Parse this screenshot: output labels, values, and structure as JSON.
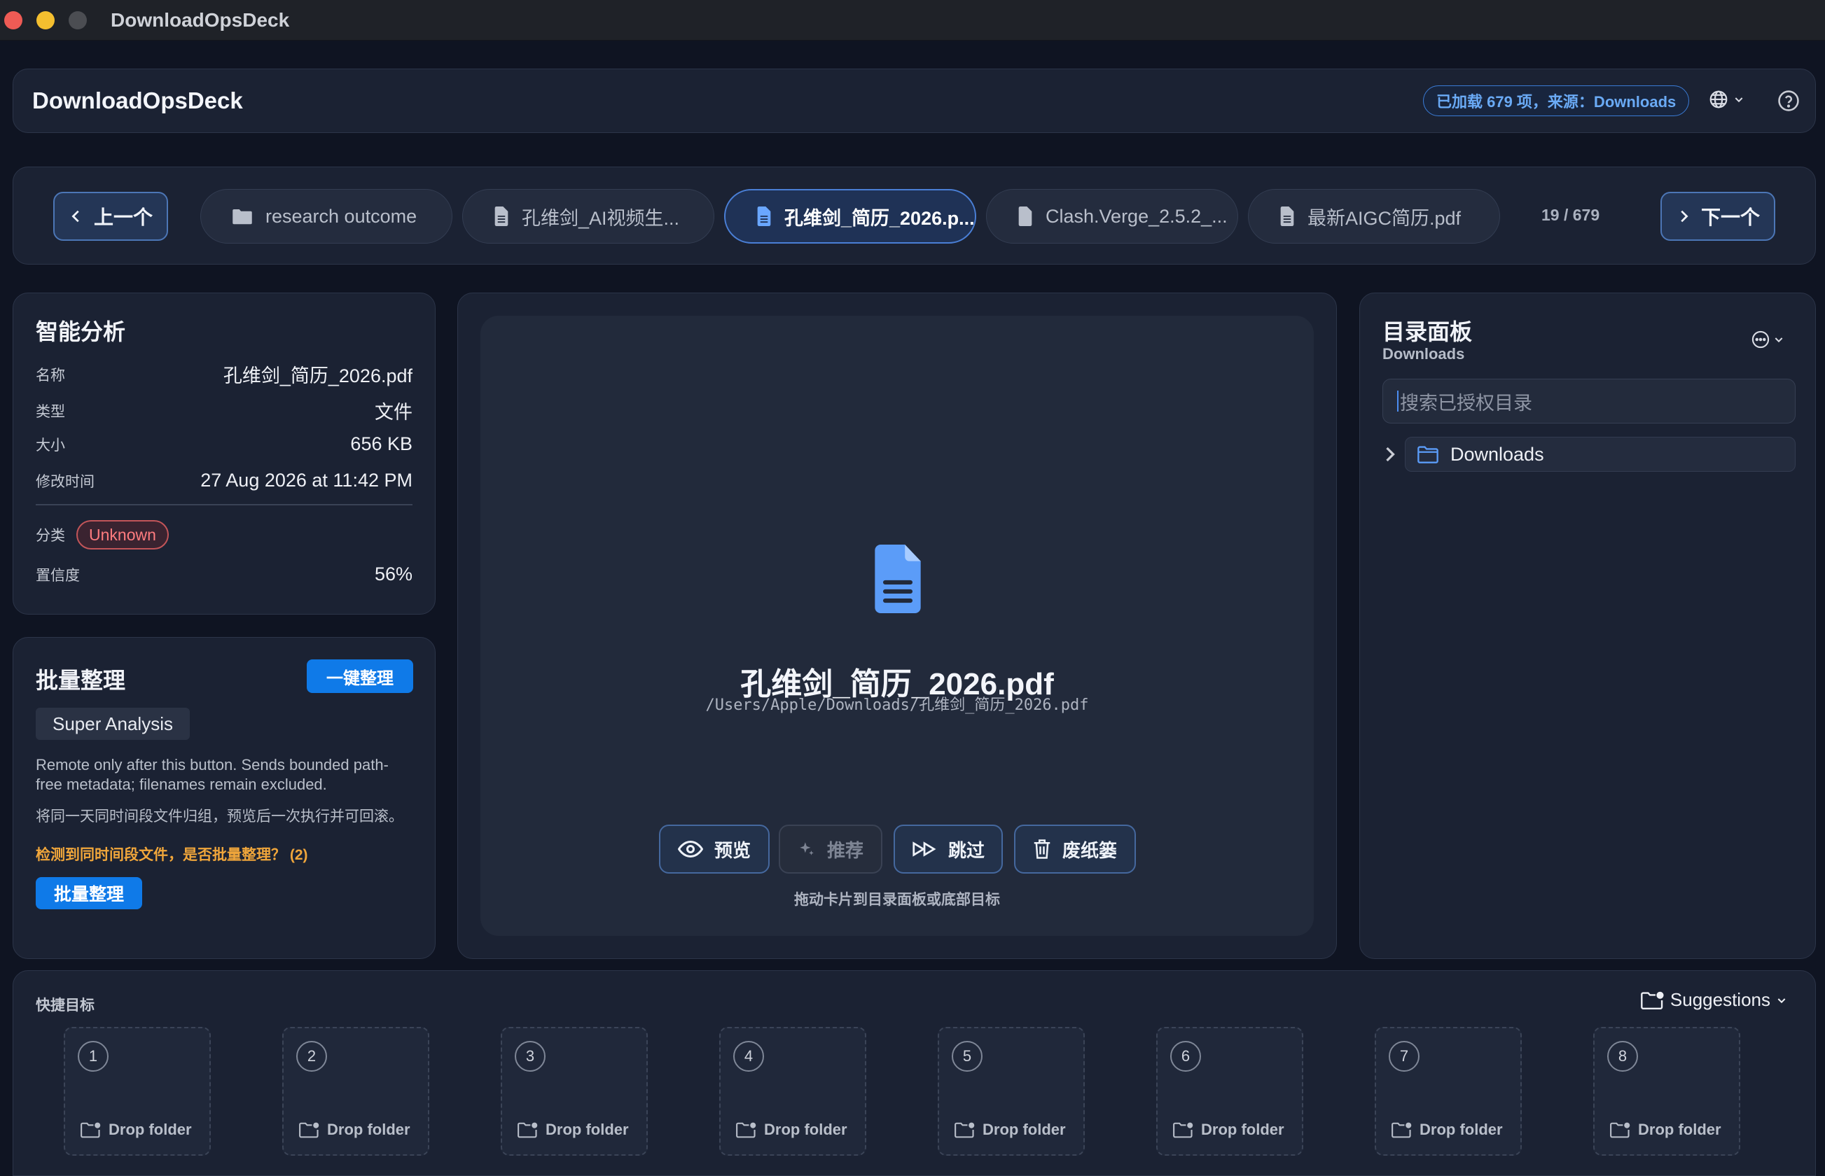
{
  "window": {
    "title": "DownloadOpsDeck"
  },
  "header": {
    "app_name": "DownloadOpsDeck",
    "status": "已加载 679 项，来源：Downloads"
  },
  "nav": {
    "prev_label": "上一个",
    "next_label": "下一个",
    "counter": "19 / 679",
    "tabs": [
      {
        "label": "research outcome",
        "icon": "folder-icon",
        "active": false
      },
      {
        "label": "孔维剑_AI视频生...",
        "icon": "document-icon",
        "active": false
      },
      {
        "label": "孔维剑_简历_2026.p...",
        "icon": "document-icon",
        "active": true
      },
      {
        "label": "Clash.Verge_2.5.2_...",
        "icon": "file-icon",
        "active": false
      },
      {
        "label": "最新AIGC简历.pdf",
        "icon": "document-icon",
        "active": false
      }
    ]
  },
  "analysis": {
    "title": "智能分析",
    "rows": [
      {
        "key": "名称",
        "value": "孔维剑_简历_2026.pdf"
      },
      {
        "key": "类型",
        "value": "文件"
      },
      {
        "key": "大小",
        "value": "656 KB"
      },
      {
        "key": "修改时间",
        "value": "27 Aug 2026 at 11:42 PM"
      }
    ],
    "category_key": "分类",
    "category_value": "Unknown",
    "confidence_key": "置信度",
    "confidence_value": "56%"
  },
  "batch": {
    "title": "批量整理",
    "one_click_label": "一键整理",
    "super_analysis_label": "Super Analysis",
    "note_remote": "Remote only after this button. Sends bounded path-free metadata; filenames remain excluded.",
    "note_group": "将同一天同时间段文件归组，预览后一次执行并可回滚。",
    "warning": "检测到同时间段文件，是否批量整理？ (2)",
    "batch_button_label": "批量整理"
  },
  "preview": {
    "file_name": "孔维剑_简历_2026.pdf",
    "file_path": "/Users/Apple/Downloads/孔维剑_简历_2026.pdf",
    "actions": {
      "preview": "预览",
      "recommend": "推荐",
      "skip": "跳过",
      "trash": "废纸篓"
    },
    "drag_hint": "拖动卡片到目录面板或底部目标"
  },
  "directory": {
    "title": "目录面板",
    "subtitle": "Downloads",
    "search_placeholder": "搜索已授权目录",
    "tree": [
      {
        "label": "Downloads"
      }
    ]
  },
  "quick_targets": {
    "title": "快捷目标",
    "suggestions_label": "Suggestions",
    "slots": [
      {
        "num": "1",
        "label": "Drop folder"
      },
      {
        "num": "2",
        "label": "Drop folder"
      },
      {
        "num": "3",
        "label": "Drop folder"
      },
      {
        "num": "4",
        "label": "Drop folder"
      },
      {
        "num": "5",
        "label": "Drop folder"
      },
      {
        "num": "6",
        "label": "Drop folder"
      },
      {
        "num": "7",
        "label": "Drop folder"
      },
      {
        "num": "8",
        "label": "Drop folder"
      }
    ]
  },
  "colors": {
    "accent": "#0f7ae8",
    "category_unknown": "#ff7c7f",
    "warning": "#f0a63b"
  }
}
